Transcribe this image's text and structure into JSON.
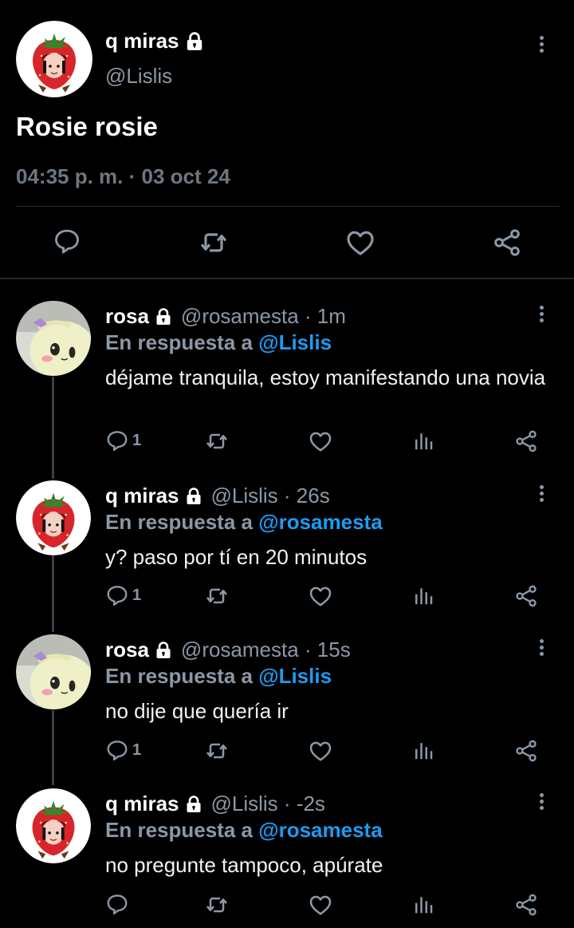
{
  "main_tweet": {
    "name": "q miras",
    "handle": "@Lislis",
    "text": "Rosie rosie",
    "timestamp": "04:35 p. m. · 03 oct 24",
    "actions": [
      "reply-icon",
      "retweet-icon",
      "like-icon",
      "share-icon"
    ]
  },
  "replies": [
    {
      "name": "rosa",
      "meta": "@rosamesta · 1m",
      "in_reply_prefix": "En respuesta a",
      "mention": "@Lislis",
      "text": "déjame tranquila, estoy manifestando una novia",
      "reply_count": "1",
      "avatar": "plush-avatar"
    },
    {
      "name": "q miras",
      "meta": "@Lislis · 26s",
      "in_reply_prefix": "En respuesta a",
      "mention": "@rosamesta",
      "text": "y? paso por tí en 20 minutos",
      "reply_count": "1",
      "avatar": "strawberry-avatar"
    },
    {
      "name": "rosa",
      "meta": "@rosamesta · 15s",
      "in_reply_prefix": "En respuesta a",
      "mention": "@Lislis",
      "text": "no dije que quería ir",
      "reply_count": "1",
      "avatar": "plush-avatar"
    },
    {
      "name": "q miras",
      "meta": "@Lislis · -2s",
      "in_reply_prefix": "En respuesta a",
      "mention": "@rosamesta",
      "text": "no pregunte tampoco, apúrate",
      "reply_count": "",
      "avatar": "strawberry-avatar"
    }
  ],
  "colors": {
    "background": "#000000",
    "secondary_text": "#8b98a5",
    "mention": "#1d9bf0"
  }
}
